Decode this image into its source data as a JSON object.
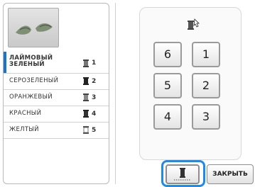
{
  "thread_list": {
    "items": [
      {
        "label": "ЛАЙМОВЫЙ ЗЕЛЕНЫЙ",
        "number": "1",
        "spool": "spool-icon-light"
      },
      {
        "label": "СЕРОЗЕЛЕНЫЙ",
        "number": "2",
        "spool": "spool-icon-dark"
      },
      {
        "label": "ОРАНЖЕВЫЙ",
        "number": "3",
        "spool": "spool-icon-light"
      },
      {
        "label": "КРАСНЫЙ",
        "number": "4",
        "spool": "spool-icon-dark"
      },
      {
        "label": "ЖЕЛТЫЙ",
        "number": "5",
        "spool": "spool-icon-outline"
      }
    ]
  },
  "needle_grid": {
    "buttons": [
      "6",
      "1",
      "5",
      "2",
      "4",
      "3"
    ]
  },
  "footer": {
    "close_label": "ЗАКРЫТЬ"
  },
  "colors": {
    "highlight": "#1e8be8",
    "selected": "#1e73c8"
  }
}
